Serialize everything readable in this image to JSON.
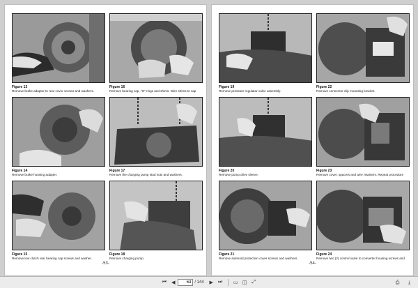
{
  "left_page": {
    "page_number": "-53-",
    "figures": [
      {
        "title": "Figure 13",
        "caption": "Remove brake adapter to rear cover screws and washers."
      },
      {
        "title": "Figure 16",
        "caption": "Remove bearing cap, \"O\" rings and shims. Wire shims to cap"
      },
      {
        "title": "Figure 14",
        "caption": "Remove brake housing adapter."
      },
      {
        "title": "Figure 17",
        "caption": "Remove the charging pump stud nuts and washers."
      },
      {
        "title": "Figure 15",
        "caption": "Remove low clutch rear bearing cap screws and washer."
      },
      {
        "title": "Figure 18",
        "caption": "Remove charging pump."
      }
    ]
  },
  "right_page": {
    "page_number": "-54-",
    "figures": [
      {
        "title": "Figure 19",
        "caption": "Remove pressure regulator valve assembly."
      },
      {
        "title": "Figure 22",
        "caption": "Remove connector clip mounting bracket."
      },
      {
        "title": "Figure 20",
        "caption": "Remove pump drive sleeve."
      },
      {
        "title": "Figure 23",
        "caption": "Remove cover, spacers and wire retainers. Repeat procedure"
      },
      {
        "title": "Figure 21",
        "caption": "Remove solenoid protection cover screws and washers."
      },
      {
        "title": "Figure 24",
        "caption": "Remove two (2) control valve to converter housing screws and"
      }
    ]
  },
  "toolbar": {
    "current_page": "63",
    "total_pages": "/ 144"
  }
}
